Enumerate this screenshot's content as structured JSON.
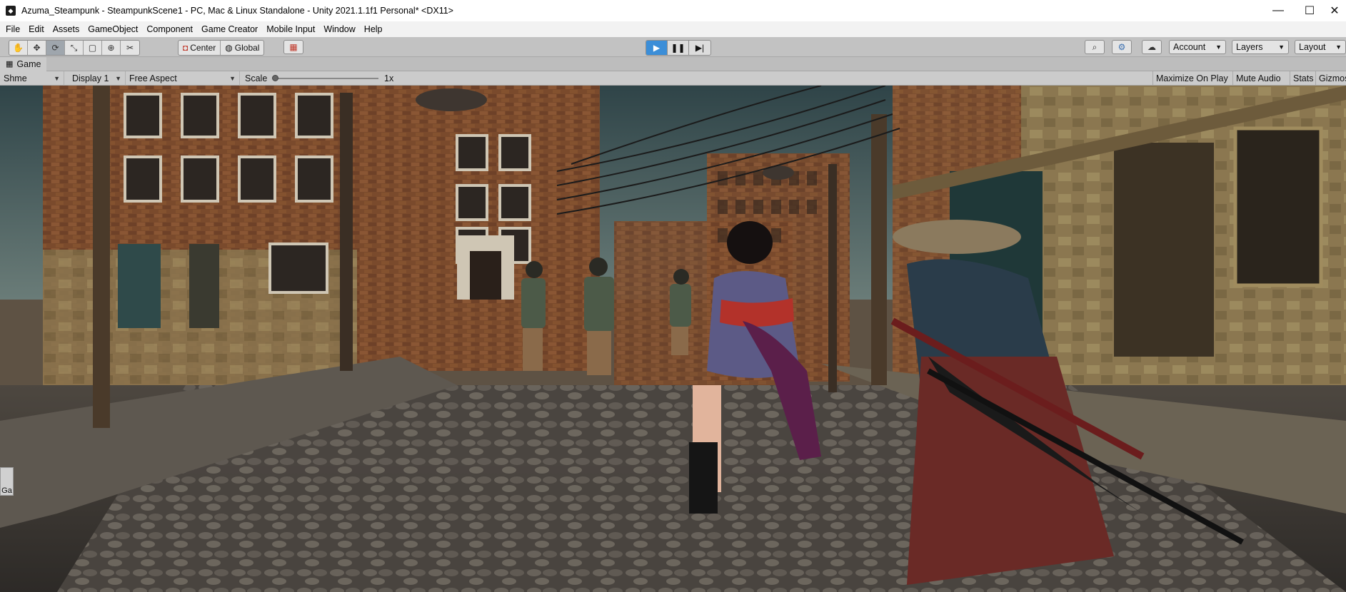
{
  "window": {
    "title": "Azuma_Steampunk - SteampunkScene1 - PC, Mac & Linux Standalone - Unity 2021.1.1f1 Personal* <DX11>",
    "logo_icon": "unity-logo-icon"
  },
  "menu": [
    "File",
    "Edit",
    "Assets",
    "GameObject",
    "Component",
    "Game Creator",
    "Mobile Input",
    "Window",
    "Help"
  ],
  "toolbar": {
    "tools": [
      "hand-tool-icon",
      "move-tool-icon",
      "rotate-tool-icon",
      "scale-tool-icon",
      "rect-tool-icon",
      "transform-tool-icon",
      "custom-tool-icon"
    ],
    "pivot_label": "Center",
    "space_label": "Global",
    "play_state": "playing",
    "account_label": "Account",
    "layers_label": "Layers",
    "layout_label": "Layout"
  },
  "game_tab": {
    "label": "Game"
  },
  "game_toolbar": {
    "shme_label": "Shme",
    "display_label": "Display 1",
    "aspect_label": "Free Aspect",
    "scale_label": "Scale",
    "scale_value": "1x",
    "scale_fraction": 0.0,
    "maximize_label": "Maximize On Play",
    "mute_label": "Mute Audio",
    "stats_label": "Stats",
    "gizmos_label": "Gizmos"
  },
  "side_handle_label": "Ga",
  "colors": {
    "sky": "#3f5a5e",
    "brick": "#7a4a2c",
    "cobblestone": "#5b5650",
    "play_active": "#3b8ed8",
    "toolbar_bg": "#c2c2c2"
  }
}
